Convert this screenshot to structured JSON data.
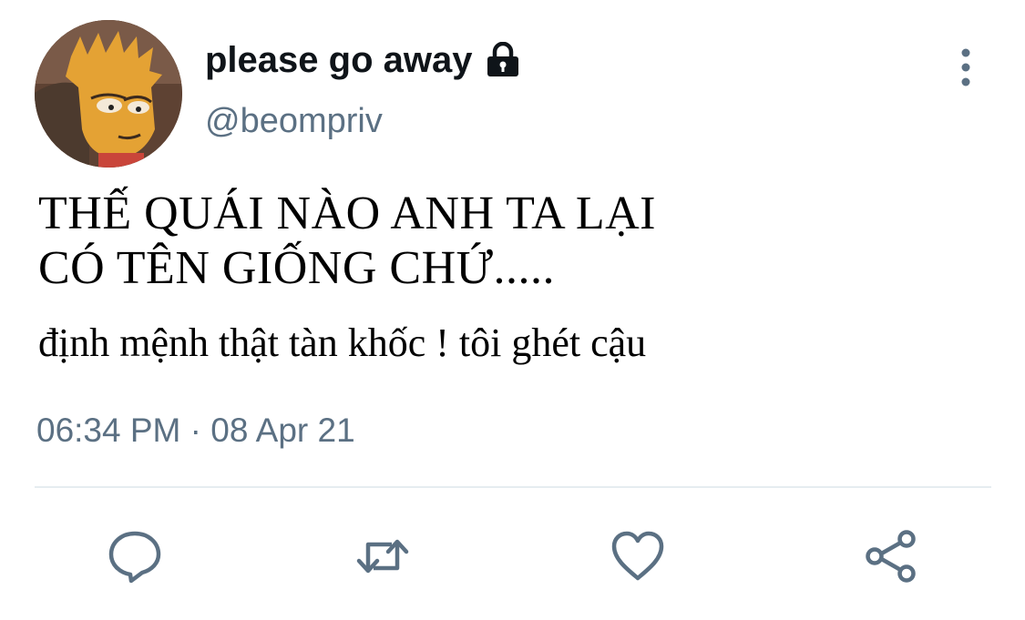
{
  "tweet": {
    "display_name": "please go away",
    "handle": "@beompriv",
    "text_lines": [
      "THẾ QUÁI NÀO ANH TA LẠI",
      "CÓ TÊN GIỐNG CHỨ.....",
      "định mệnh thật tàn khốc ! tôi ghét cậu"
    ],
    "timestamp": "06:34 PM · 08 Apr 21"
  },
  "icons": {
    "protected": "lock-icon",
    "menu": "more-vertical-icon",
    "actions": [
      "reply-icon",
      "retweet-icon",
      "like-icon",
      "share-icon"
    ]
  },
  "colors": {
    "text": "#0f1419",
    "secondary": "#5b7083",
    "divider": "#e6ecf0"
  }
}
